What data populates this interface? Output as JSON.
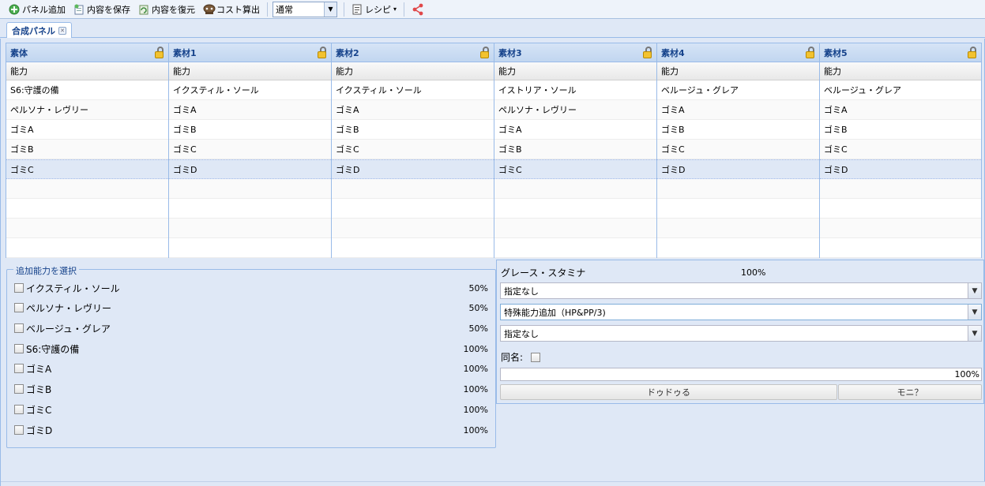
{
  "toolbar": {
    "add_panel": "パネル追加",
    "save": "内容を保存",
    "restore": "内容を復元",
    "cost": "コスト算出",
    "mode_value": "通常",
    "recipe": "レシピ",
    "icons": [
      "add-icon",
      "save-icon",
      "restore-icon",
      "cost-icon",
      "recipe-icon",
      "share-icon"
    ],
    "share_color": "#e0484a"
  },
  "tab": {
    "label": "合成パネル"
  },
  "grids": [
    {
      "title": "素体",
      "column": "能力",
      "rows": [
        "S6:守護の備",
        "ペルソナ・レヴリー",
        "ゴミA",
        "ゴミB",
        "ゴミC",
        "",
        "",
        "",
        ""
      ]
    },
    {
      "title": "素材1",
      "column": "能力",
      "rows": [
        "イクスティル・ソール",
        "ゴミA",
        "ゴミB",
        "ゴミC",
        "ゴミD",
        "",
        "",
        "",
        ""
      ]
    },
    {
      "title": "素材2",
      "column": "能力",
      "rows": [
        "イクスティル・ソール",
        "ゴミA",
        "ゴミB",
        "ゴミC",
        "ゴミD",
        "",
        "",
        "",
        ""
      ]
    },
    {
      "title": "素材3",
      "column": "能力",
      "rows": [
        "イストリア・ソール",
        "ペルソナ・レヴリー",
        "ゴミA",
        "ゴミB",
        "ゴミC",
        "",
        "",
        "",
        ""
      ]
    },
    {
      "title": "素材4",
      "column": "能力",
      "rows": [
        "ベルージュ・グレア",
        "ゴミA",
        "ゴミB",
        "ゴミC",
        "ゴミD",
        "",
        "",
        "",
        ""
      ]
    },
    {
      "title": "素材5",
      "column": "能力",
      "rows": [
        "ベルージュ・グレア",
        "ゴミA",
        "ゴミB",
        "ゴミC",
        "ゴミD",
        "",
        "",
        "",
        ""
      ]
    }
  ],
  "selected_row_index": 4,
  "ability_select": {
    "legend": "追加能力を選択",
    "items": [
      {
        "label": "イクスティル・ソール",
        "pct": "50%"
      },
      {
        "label": "ペルソナ・レヴリー",
        "pct": "50%"
      },
      {
        "label": "ベルージュ・グレア",
        "pct": "50%"
      },
      {
        "label": "S6:守護の備",
        "pct": "100%"
      },
      {
        "label": "ゴミA",
        "pct": "100%"
      },
      {
        "label": "ゴミB",
        "pct": "100%"
      },
      {
        "label": "ゴミC",
        "pct": "100%"
      },
      {
        "label": "ゴミD",
        "pct": "100%"
      }
    ]
  },
  "result": {
    "title": "グレース・スタミナ",
    "rate": "100%",
    "combo1": "指定なし",
    "combo2": "特殊能力追加（HP&PP/3)",
    "combo3": "指定なし",
    "same_name_label": "同名:",
    "progress_text": "100%",
    "btn_left": "ドゥドゥる",
    "btn_right": "モニ？"
  }
}
